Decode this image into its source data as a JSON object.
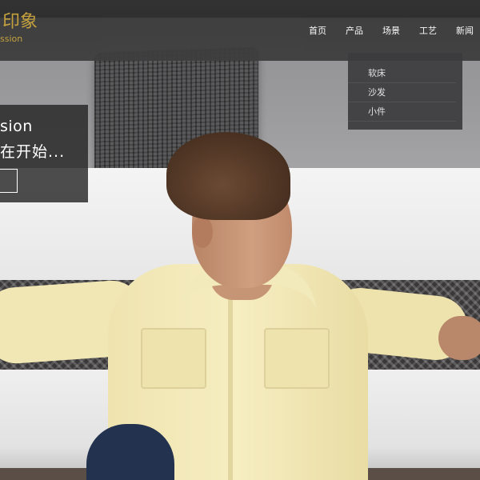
{
  "brand": {
    "name_cn": "印象",
    "name_en": "ssion",
    "color": "#c8a23a"
  },
  "nav": {
    "items": [
      "首页",
      "产品",
      "场景",
      "工艺",
      "新闻"
    ]
  },
  "dropdown": {
    "items": [
      "软床",
      "沙发",
      "小件"
    ]
  },
  "hero": {
    "caption_title": "sion",
    "caption_subtitle": "在开始..."
  },
  "colors": {
    "header_bg": "#3e3e3e",
    "dropdown_bg": "#3c3c3e",
    "caption_bg": "#222222",
    "shirt": "#f1e7b5"
  }
}
